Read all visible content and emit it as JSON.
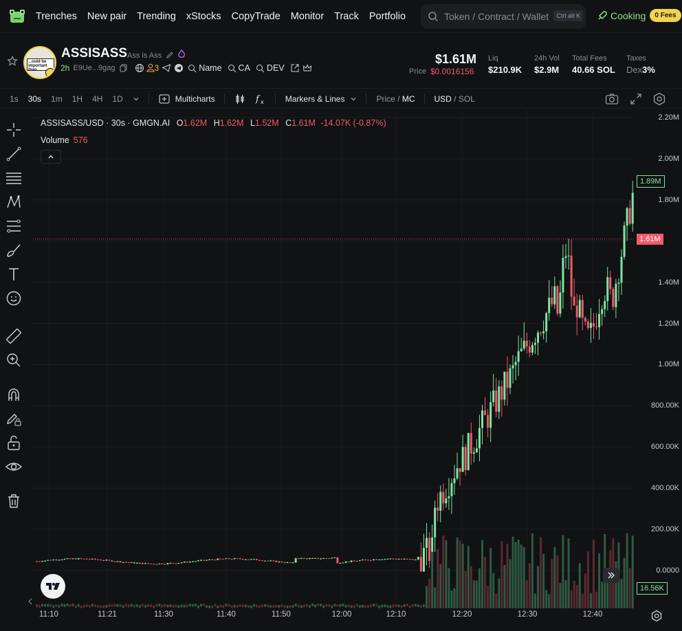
{
  "nav": {
    "items": [
      "Trenches",
      "New pair",
      "Trending",
      "xStocks",
      "CopyTrade",
      "Monitor",
      "Track",
      "Portfolio"
    ],
    "search_placeholder": "Token / Contract / Wallet",
    "search_shortcut": "Ctrl alt K",
    "cooking_label": "Cooking",
    "fees_badge": "0 Fees"
  },
  "token": {
    "symbol": "ASSISASS",
    "name": "Ass is Ass",
    "age": "2h",
    "address": "E9Ue...9gag",
    "holders_count": "3",
    "name_label": "Name",
    "ca_label": "CA",
    "dev_label": "DEV",
    "market_cap": "$1.61M",
    "price_label": "Price",
    "price_value": "$0.0016156",
    "stats": [
      {
        "key": "Liq",
        "value": "$210.9K"
      },
      {
        "key": "24h Vol",
        "value": "$2.9M"
      },
      {
        "key": "Total Fees",
        "value": "40.66 SOL"
      },
      {
        "key": "Taxes",
        "value_prefix": "Dex",
        "value": "3%"
      }
    ],
    "avatar_text": "...ould be important than ..."
  },
  "toolbar": {
    "intervals": [
      "1s",
      "30s",
      "1m",
      "1H",
      "4H",
      "1D"
    ],
    "active_interval": "30s",
    "multicharts": "Multicharts",
    "markers": "Markers & Lines",
    "price_label": "Price",
    "mc_label": "MC",
    "usd_label": "USD",
    "sol_label": "SOL"
  },
  "legend": {
    "pair": "ASSISASS/USD · 30s · GMGN.AI",
    "o_key": "O",
    "o": "1.62M",
    "h_key": "H",
    "h": "1.62M",
    "l_key": "L",
    "l": "1.52M",
    "c_key": "C",
    "c": "1.61M",
    "change": "-14.07K (-0.87%)",
    "volume_label": "Volume",
    "volume_value": "576"
  },
  "axis": {
    "y_labels": [
      "2.20M",
      "2.00M",
      "1.80M",
      "1.40M",
      "1.20M",
      "1.00M",
      "800.00K",
      "600.00K",
      "400.00K",
      "200.00K",
      "0.0000"
    ],
    "y_values": [
      2200000,
      2000000,
      1800000,
      1400000,
      1200000,
      1000000,
      800000,
      600000,
      400000,
      200000,
      0
    ],
    "x_labels": [
      "11:10",
      "11:21",
      "11:30",
      "11:40",
      "11:50",
      "12:00",
      "12:10",
      "12:20",
      "12:30",
      "12:40"
    ],
    "high_tag": "1.89M",
    "price_tag": "1.61M",
    "volume_tag": "16.56K"
  },
  "colors": {
    "up": "#7ee6a3",
    "down": "#f05a6a",
    "accent": "#f2d34c",
    "cooking": "#8be28b"
  },
  "chart_data": {
    "type": "candlestick",
    "y_range": [
      0,
      2200000
    ],
    "current_price": 1610000,
    "peak_high": 1890000
  }
}
